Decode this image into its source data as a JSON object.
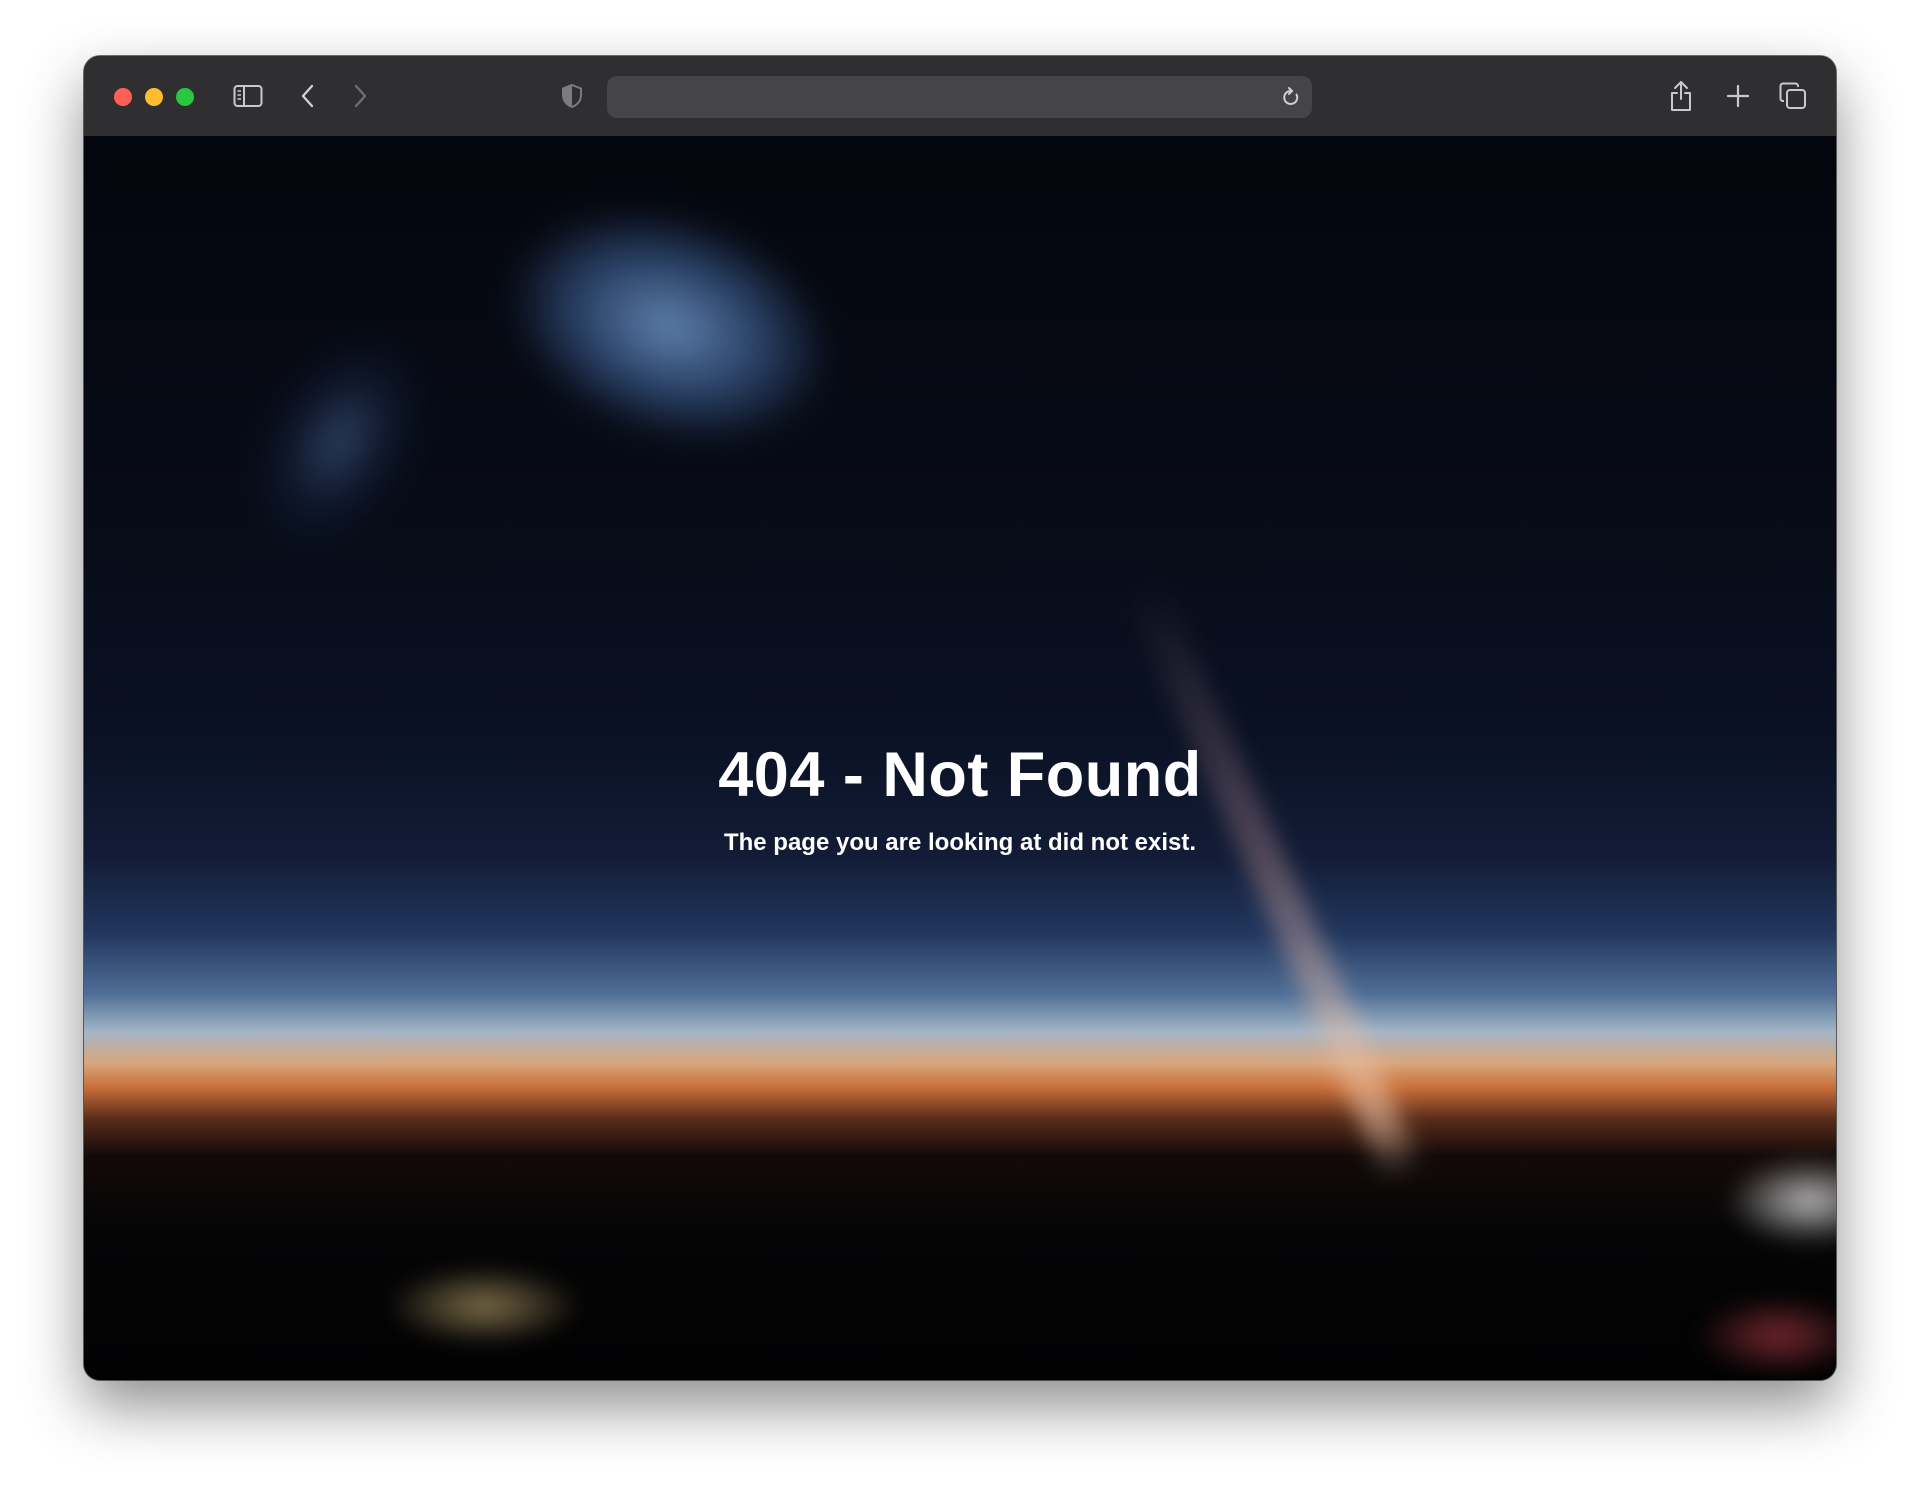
{
  "browser": {
    "address_bar": {
      "value": ""
    },
    "icons": {
      "sidebar": "sidebar-icon",
      "back": "chevron-left-icon",
      "forward": "chevron-right-icon",
      "privacy": "shield-icon",
      "reload": "reload-icon",
      "share": "share-icon",
      "new_tab": "plus-icon",
      "tab_overview": "tabs-icon"
    },
    "traffic_lights": {
      "close": "#ff5f57",
      "minimize": "#febc2e",
      "zoom": "#28c840"
    }
  },
  "page": {
    "title": "404 - Not Found",
    "message": "The page you are looking at did not exist."
  }
}
